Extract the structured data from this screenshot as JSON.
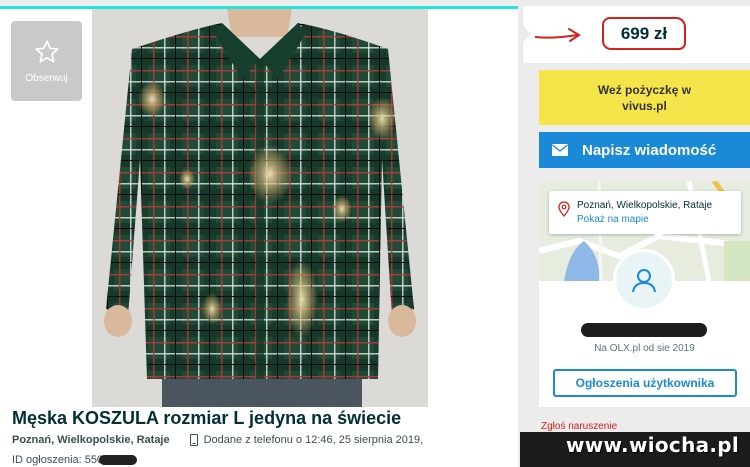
{
  "listing": {
    "follow_label": "Obserwuj",
    "title": "Męska KOSZULA rozmiar L jedyna na świecie",
    "location": "Poznań, Wielkopolskie, Rataje",
    "added_text": "Dodane z telefonu   o 12:46, 25 sierpnia 2019,",
    "id_label": "ID ogłoszenia: 550"
  },
  "price": {
    "value": "699 zł",
    "annotation_color": "#d6201c"
  },
  "loan": {
    "line1": "Weź pożyczkę w",
    "line2": "vivus.pl"
  },
  "message_button": {
    "label": "Napisz wiadomość"
  },
  "seller": {
    "location": "Poznań, Wielkopolskie, Rataje",
    "show_map": "Pokaż na mapie",
    "since": "Na OLX.pl od sie 2019",
    "user_ads_button": "Ogłoszenia użytkownika"
  },
  "report_link": "Zgłoś naruszenie",
  "watermark": "www.wiocha.pl",
  "colors": {
    "accent_blue": "#1a8ad8",
    "loan_yellow": "#f5e54b",
    "text_dark": "#002f34"
  },
  "icons": {
    "follow": "star-icon",
    "phone": "phone-icon",
    "message": "envelope-icon",
    "map_pin": "map-pin-icon",
    "avatar": "user-icon",
    "annotation": "red-arrow-icon"
  }
}
